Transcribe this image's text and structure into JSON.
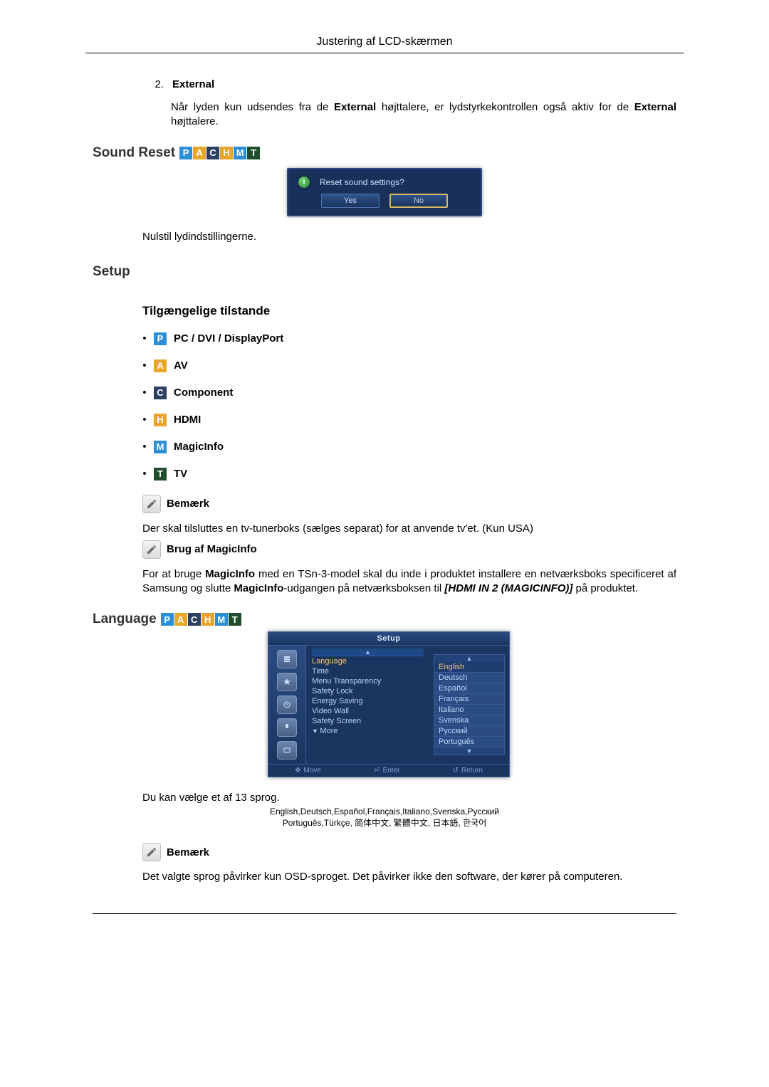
{
  "header": {
    "title": "Justering af LCD-skærmen"
  },
  "external": {
    "num": "2.",
    "label": "External",
    "para_a": "Når lyden kun udsendes fra de ",
    "para_b": "External",
    "para_c": " højttalere, er lydstyrkekontrollen også aktiv for de ",
    "para_d": "External",
    "para_e": " højttalere."
  },
  "sound_reset": {
    "title": "Sound Reset",
    "dialog_question": "Reset sound settings?",
    "yes": "Yes",
    "no": "No",
    "reset_text": "Nulstil lydindstillingerne."
  },
  "setup": {
    "title": "Setup",
    "modes_title": "Tilgængelige tilstande",
    "modes": [
      {
        "badge": "P",
        "cls": "badge-P",
        "label": "PC / DVI / DisplayPort"
      },
      {
        "badge": "A",
        "cls": "badge-A",
        "label": "AV"
      },
      {
        "badge": "C",
        "cls": "badge-C",
        "label": "Component"
      },
      {
        "badge": "H",
        "cls": "badge-H",
        "label": "HDMI"
      },
      {
        "badge": "M",
        "cls": "badge-M",
        "label": "MagicInfo"
      },
      {
        "badge": "T",
        "cls": "badge-T",
        "label": "TV"
      }
    ],
    "note1_label": "Bemærk",
    "note1_text": "Der skal tilsluttes en tv-tunerboks (sælges separat) for at anvende tv'et. (Kun USA)",
    "magic_label": "Brug af MagicInfo",
    "magic_a": "For at bruge ",
    "magic_b": "MagicInfo",
    "magic_c": " med en TSn-3-model skal du inde i produktet installere en netværksboks specificeret af Samsung og slutte ",
    "magic_d": "MagicInfo",
    "magic_e": "-udgangen på netværksboksen til ",
    "magic_f": "[HDMI IN 2 (MAGICINFO)]",
    "magic_g": " på produktet."
  },
  "language": {
    "title": "Language",
    "osd_title": "Setup",
    "menu_items": [
      "Language",
      "Time",
      "Menu Transparency",
      "Safety Lock",
      "Energy Saving",
      "Video Wall",
      "Safety Screen",
      "More"
    ],
    "lang_options": [
      "English",
      "Deutsch",
      "Español",
      "Français",
      "Italiano",
      "Svenska",
      "Русский",
      "Português"
    ],
    "footer": {
      "move": "Move",
      "enter": "Enter",
      "return": "Return"
    },
    "select_text": "Du kan vælge et af 13 sprog.",
    "avail1": "English,Deutsch,Español,Français,Italiano,Svenska,Русский",
    "avail2": "Português,Türkçe, 简体中文,  繁體中文, 日本語, 한국어",
    "note_label": "Bemærk",
    "note_text": "Det valgte sprog påvirker kun OSD-sproget. Det påvirker ikke den software, der kører på computeren."
  },
  "badges": {
    "P": "P",
    "A": "A",
    "C": "C",
    "H": "H",
    "M": "M",
    "T": "T"
  }
}
